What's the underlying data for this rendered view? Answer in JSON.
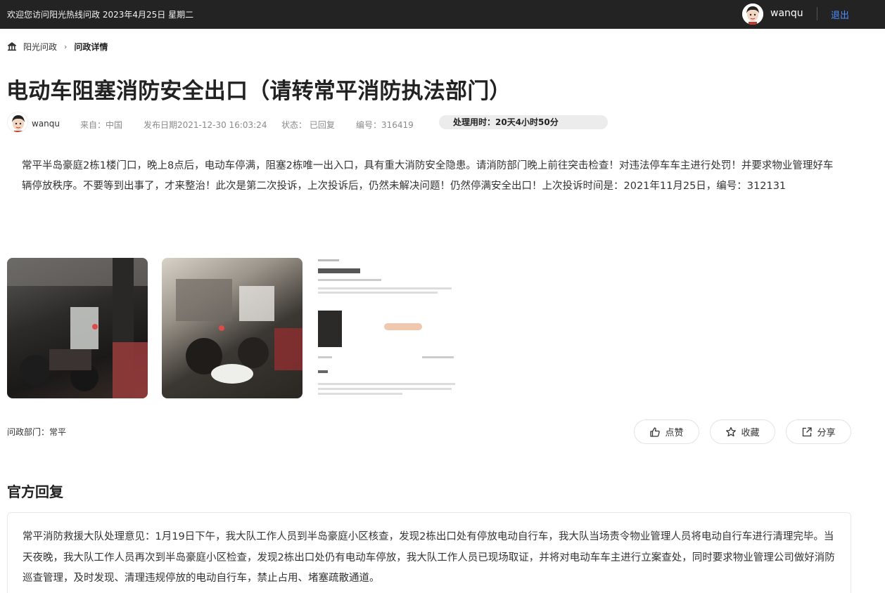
{
  "topbar": {
    "welcome": "欢迎您访问阳光热线问政 2023年4月25日 星期二",
    "username": "wanqu",
    "logout": "退出"
  },
  "breadcrumb": {
    "home": "阳光问政",
    "current": "问政详情"
  },
  "post": {
    "title": "电动车阻塞消防安全出口（请转常平消防执法部门）",
    "author": "wanqu",
    "source": "来自：中国",
    "published": "发布日期2021-12-30 16:03:24",
    "status": "状态： 已回复",
    "number": "编号：316419",
    "processing_time": "处理用时：20天4小时50分",
    "content": "常平半岛豪庭2栋1楼门口，晚上8点后，电动车停满，阻塞2栋唯一出入口，具有重大消防安全隐患。请消防部门晚上前往突击检查！对违法停车车主进行处罚！并要求物业管理好车辆停放秩序。不要等到出事了，才来整治！此次是第二次投诉，上次投诉后，仍然未解决问题！仍然停满安全出口！上次投诉时间是：2021年11月25日，编号：312131",
    "department": "问政部门：常平"
  },
  "actions": {
    "like": "点赞",
    "favorite": "收藏",
    "share": "分享"
  },
  "reply": {
    "heading": "官方回复",
    "text": "常平消防救援大队处理意见：1月19日下午，我大队工作人员到半岛豪庭小区核查，发现2栋出口处有停放电动自行车，我大队当场责令物业管理人员将电动自行车进行清理完毕。当天夜晚，我大队工作人员再次到半岛豪庭小区检查，发现2栋出口处仍有电动车停放，我大队工作人员已现场取证，并将对电动车车主进行立案查处，同时要求物业管理公司做好消防巡查管理，及时发现、清理违规停放的电动自行车，禁止占用、堵塞疏散通道。"
  },
  "colors": {
    "topbar_bg": "#232323",
    "logout_link": "#4d8dff",
    "timer_bg": "#ececec"
  }
}
